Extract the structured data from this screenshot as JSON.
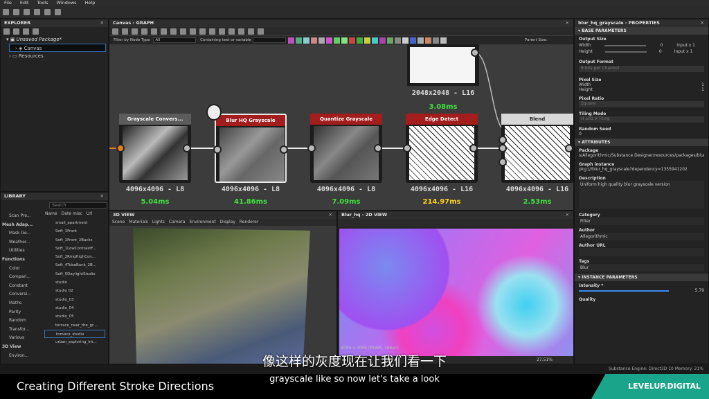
{
  "menu": [
    "File",
    "Edit",
    "Tools",
    "Windows",
    "Help"
  ],
  "explorer": {
    "title": "EXPLORER",
    "package": "Unsaved Package*",
    "canvas": "Canvas",
    "resources": "Resources"
  },
  "library": {
    "title": "LIBRARY",
    "search": "Search",
    "cols": [
      "Name",
      "Date misc",
      "Url"
    ],
    "cats": [
      "Scan Pro...",
      "Mesh Adap...",
      "Mask Ge...",
      "Weather...",
      "Utilities",
      "Functions",
      "Color",
      "Compari...",
      "Constant",
      "Conversi...",
      "Maths",
      "Parity",
      "Random",
      "Transfor...",
      "Various",
      "3D View",
      "Environ..."
    ],
    "items": [
      "small_apartment",
      "Soft_1Front",
      "Soft_1Front_2Backs",
      "Soft_1LowContrastF...",
      "Soft_2RingHighCon...",
      "Soft_4TubeBank_2B...",
      "Soft_5DaylightStudio",
      "studio",
      "studio 02",
      "studio_03",
      "studio_04",
      "studio_05",
      "terrace_near_the_gr...",
      "tomoco_studio",
      "urban_exploring_int..."
    ]
  },
  "graph": {
    "title": "Canvas - GRAPH",
    "filter_label": "Filter by Node Type",
    "filter_value": "All",
    "text_label": "Containing text or variable",
    "parent_size": "Parent Size:",
    "nodes": [
      {
        "name": "Grayscale Convers...",
        "res": "4096x4096 - L8",
        "time": "5.04ms",
        "color": "#5c5c5c",
        "tcolor": "#3fe03f"
      },
      {
        "name": "Blur HQ Grayscale",
        "res": "4096x4096 - L8",
        "time": "41.86ms",
        "color": "#a41d1d",
        "tcolor": "#3fe03f"
      },
      {
        "name": "Quantize Grayscale",
        "res": "4096x4096 - L8",
        "time": "7.09ms",
        "color": "#a41d1d",
        "tcolor": "#3fe03f"
      },
      {
        "name": "Edge Detect",
        "res": "4096x4096 - L16",
        "time": "214.97ms",
        "color": "#a41d1d",
        "tcolor": "#ffd21a"
      },
      {
        "name": "Blend",
        "res": "4096x4096 - L16",
        "time": "2.53ms",
        "color": "#d8d8d8",
        "tcolor": "#3fe03f"
      }
    ],
    "top_node": {
      "res": "2048x2048 - L16",
      "time": "3.08ms"
    }
  },
  "view3d": {
    "title": "3D VIEW",
    "menu": [
      "Scene",
      "Materials",
      "Lights",
      "Camera",
      "Environment",
      "Display",
      "Renderer"
    ]
  },
  "view2d": {
    "title": "Blur_hq - 2D VIEW",
    "status": "4096 x 4096 (RGBA, 16bpc)",
    "zoom": "27.51%"
  },
  "props": {
    "title": "blur_hq_grayscale - PROPERTIES",
    "base": "BASE PARAMETERS",
    "output_size": "Output Size",
    "width": "Width",
    "height": "Height",
    "ow": "0",
    "oh": "0",
    "iw": "Input x 1",
    "ih": "Input x 1",
    "output_format": "Output Format",
    "of_value": "8 bits per Channel",
    "pixel_size": "Pixel Size",
    "pw": "1",
    "ph": "1",
    "pixel_ratio": "Pixel Ratio",
    "pr_value": "Square",
    "tiling": "Tiling Mode",
    "t_value": "H and V Tiling",
    "seed": "Random Seed",
    "seed_value": "0",
    "attributes": "ATTRIBUTES",
    "package": "Package",
    "package_value": "s/Allegorithmic/Substance Designer/resources/packages/blur_hq.sbs",
    "graph_instance": "Graph instance",
    "gi_value": "pkg:///blur_hq_grayscale?dependency=1355941202",
    "description": "Description",
    "desc_value": "Uniform high quality blur grayscale version",
    "category": "Category",
    "cat_value": "Filter",
    "author": "Author",
    "author_value": "Allegorithmic",
    "author_url": "Author URL",
    "tags": "Tags",
    "tags_value": "Blur",
    "instance": "INSTANCE PARAMETERS",
    "intensity": "Intensity *",
    "intensity_value": "5.79",
    "quality": "Quality"
  },
  "statusbar": "Substance Engine: Direct3D 10   Memory: 21%",
  "subtitle_cn": "像这样的灰度现在让我们看一下",
  "subtitle_en": "grayscale like so now let's take a look",
  "footer_title": "Creating Different Stroke Directions",
  "brand": "LEVELUP.DIGITAL"
}
